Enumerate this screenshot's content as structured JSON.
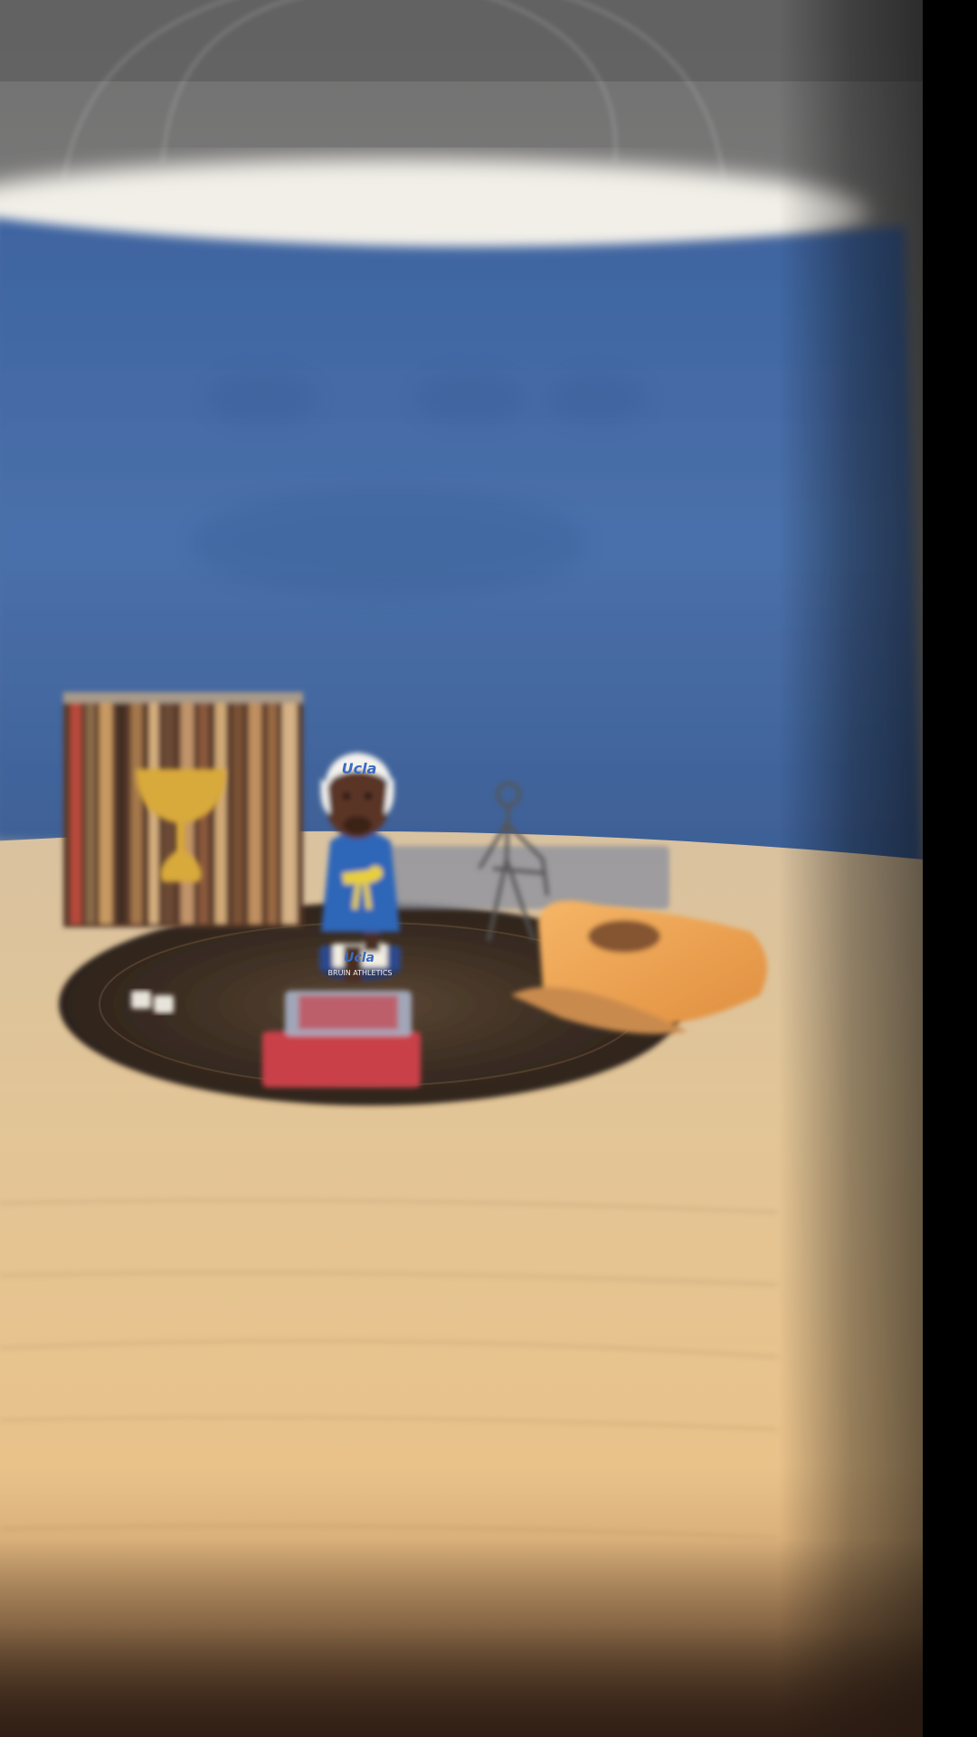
{
  "scene": {
    "description_colors": {
      "backdrop": "#4a6fa6",
      "table": "#e3c18f",
      "record": "#3b2e24",
      "cap": "#f0a85a",
      "robe": "#2f66b8",
      "belt": "#e8cf3a",
      "goblet": "#d8a93a"
    }
  },
  "bobblehead": {
    "helmet_text": "Ucla",
    "base_text": "Ucla",
    "base_band_text": "BRUIN ATHLETICS"
  }
}
